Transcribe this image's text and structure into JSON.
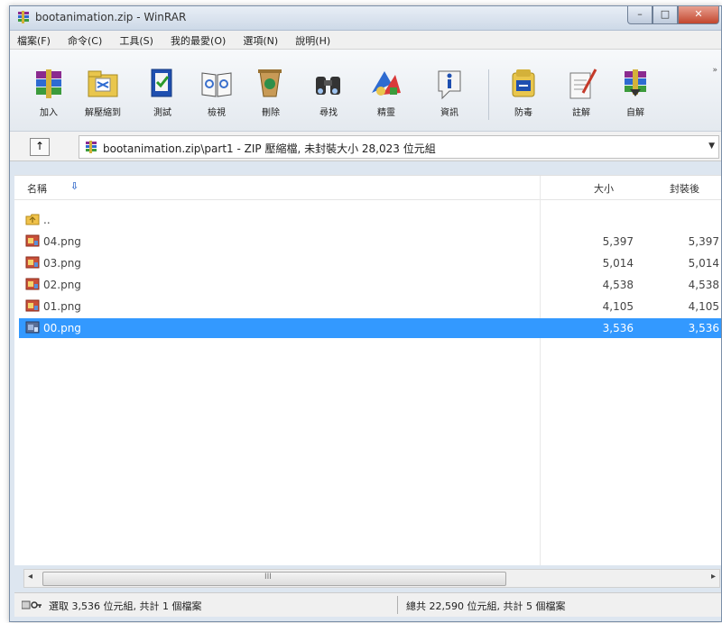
{
  "window": {
    "title": "bootanimation.zip - WinRAR",
    "min_label": "–",
    "max_label": "□",
    "close_label": "✕"
  },
  "menu": [
    "檔案(F)",
    "命令(C)",
    "工具(S)",
    "我的最愛(O)",
    "選項(N)",
    "說明(H)"
  ],
  "toolbar": {
    "buttons": [
      {
        "label": "加入",
        "icon": "add-archive-icon"
      },
      {
        "label": "解壓縮到",
        "icon": "extract-to-icon"
      },
      {
        "label": "測試",
        "icon": "test-icon"
      },
      {
        "label": "檢視",
        "icon": "view-icon"
      },
      {
        "label": "刪除",
        "icon": "delete-icon"
      },
      {
        "label": "尋找",
        "icon": "find-icon"
      },
      {
        "label": "精靈",
        "icon": "wizard-icon"
      },
      {
        "label": "資訊",
        "icon": "info-icon"
      },
      {
        "label": "防毒",
        "icon": "virus-scan-icon"
      },
      {
        "label": "註解",
        "icon": "comment-icon"
      },
      {
        "label": "自解",
        "icon": "sfx-icon"
      }
    ],
    "more_label": "»"
  },
  "path": {
    "up_label": "↑",
    "text": "bootanimation.zip\\part1 - ZIP 壓縮檔, 未封裝大小 28,023 位元組",
    "dropdown": "▼"
  },
  "columns": {
    "name": "名稱",
    "sort_icon": "⇩",
    "size": "大小",
    "packed": "封裝後"
  },
  "files": [
    {
      "name": "..",
      "size": "",
      "packed": "",
      "icon": "folder-up-icon"
    },
    {
      "name": "04.png",
      "size": "5,397",
      "packed": "5,397",
      "icon": "png-file-icon"
    },
    {
      "name": "03.png",
      "size": "5,014",
      "packed": "5,014",
      "icon": "png-file-icon"
    },
    {
      "name": "02.png",
      "size": "4,538",
      "packed": "4,538",
      "icon": "png-file-icon"
    },
    {
      "name": "01.png",
      "size": "4,105",
      "packed": "4,105",
      "icon": "png-file-icon"
    },
    {
      "name": "00.png",
      "size": "3,536",
      "packed": "3,536",
      "icon": "png-file-icon",
      "selected": true
    }
  ],
  "scrollbar": {
    "left_arrow": "◂",
    "right_arrow": "▸",
    "grip": "III"
  },
  "status": {
    "left": "選取 3,536 位元組, 共計 1 個檔案",
    "right": "總共 22,590 位元組, 共計 5 個檔案"
  },
  "colors": {
    "selection": "#3399ff",
    "window_frame": "#dde6f0"
  }
}
